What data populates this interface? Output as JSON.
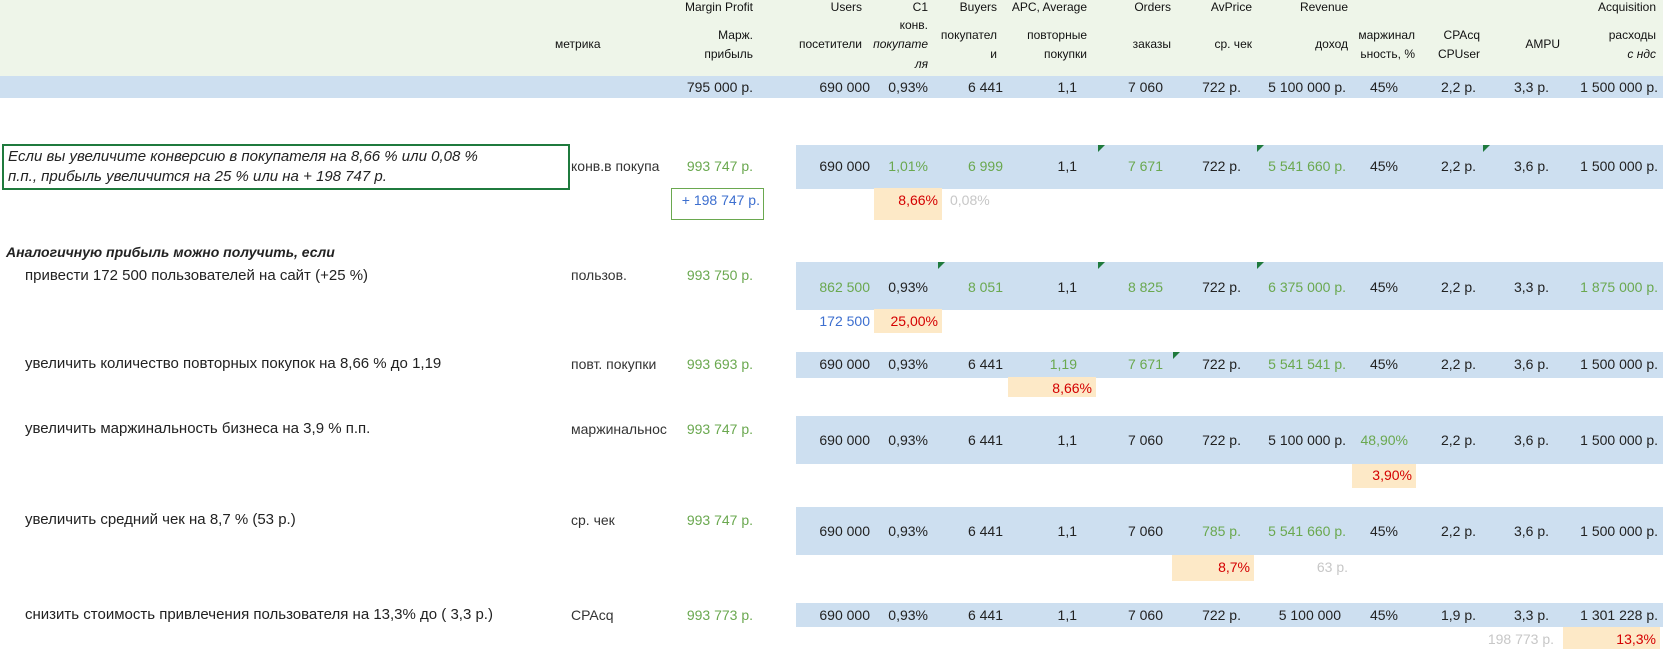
{
  "headers": {
    "metric": "метрика",
    "margin_profit": [
      "Margin Profit",
      "Марж.",
      "прибыль"
    ],
    "users": [
      "Users",
      "посетители"
    ],
    "c1": [
      "C1",
      "конв.",
      "покупате",
      "ля"
    ],
    "buyers": [
      "Buyers",
      "покупател",
      "и"
    ],
    "apc": [
      "APC, Average",
      "повторные",
      "покупки"
    ],
    "orders": [
      "Orders",
      "заказы"
    ],
    "avprice": [
      "AvPrice",
      "ср. чек"
    ],
    "revenue": [
      "Revenue",
      "доход"
    ],
    "margin": [
      "маржинал",
      "ьность, %"
    ],
    "cpacq": [
      "CPAcq",
      "CPUser"
    ],
    "ampu": "AMPU",
    "acquisition": [
      "Acquisition",
      "расходы",
      "с ндс"
    ]
  },
  "base_row": {
    "margin_profit": "795 000 р.",
    "users": "690 000",
    "c1": "0,93%",
    "buyers": "6 441",
    "apc": "1,1",
    "orders": "7 060",
    "avprice": "722 р.",
    "revenue": "5 100 000 р.",
    "margin": "45%",
    "cpacq": "2,2 р.",
    "ampu": "3,3 р.",
    "acq": "1 500 000 р."
  },
  "scenario1": {
    "text_line1": "Если вы увеличите конверсию в покупателя на 8,66 % или 0,08 %",
    "text_line2": "п.п., прибыль увеличится на  25 % или на + 198 747  р.",
    "metric": "конв.в покупа",
    "margin_profit": "993 747 р.",
    "users": "690 000",
    "c1": "1,01%",
    "buyers": "6 999",
    "apc": "1,1",
    "orders": "7 671",
    "avprice": "722 р.",
    "revenue": "5 541 660 р.",
    "margin": "45%",
    "cpacq": "2,2 р.",
    "ampu": "3,6 р.",
    "acq": "1 500 000 р.",
    "delta": "+ 198 747 р.",
    "c1_change": "8,66%",
    "c1_pp": "0,08%"
  },
  "similar_title": "Аналогичную прибыль можно получить, если",
  "scenario2": {
    "text": "привести 172 500 пользователей на сайт (+25 %)",
    "metric": "пользов.",
    "margin_profit": "993 750 р.",
    "users": "862 500",
    "c1": "0,93%",
    "buyers": "8 051",
    "apc": "1,1",
    "orders": "8 825",
    "avprice": "722 р.",
    "revenue": "6 375 000 р.",
    "margin": "45%",
    "cpacq": "2,2 р.",
    "ampu": "3,3 р.",
    "acq": "1 875 000 р.",
    "users_delta": "172 500",
    "users_change": "25,00%"
  },
  "scenario3": {
    "text": "увеличить количество повторных покупок на 8,66 % до 1,19",
    "metric": "повт. покупки",
    "margin_profit": "993 693 р.",
    "users": "690 000",
    "c1": "0,93%",
    "buyers": "6 441",
    "apc": "1,19",
    "orders": "7 671",
    "avprice": "722 р.",
    "revenue": "5 541 541 р.",
    "margin": "45%",
    "cpacq": "2,2 р.",
    "ampu": "3,6 р.",
    "acq": "1 500 000 р.",
    "apc_change": "8,66%"
  },
  "scenario4": {
    "text": "увеличить маржинальность бизнеса на 3,9 % п.п.",
    "metric": "маржинальнос",
    "margin_profit": "993 747 р.",
    "users": "690 000",
    "c1": "0,93%",
    "buyers": "6 441",
    "apc": "1,1",
    "orders": "7 060",
    "avprice": "722 р.",
    "revenue": "5 100 000 р.",
    "margin": "48,90%",
    "cpacq": "2,2 р.",
    "ampu": "3,6 р.",
    "acq": "1 500 000 р.",
    "margin_change": "3,90%"
  },
  "scenario5": {
    "text": "увеличить средний чек на 8,7 % (53 р.)",
    "metric": "ср. чек",
    "margin_profit": "993 747 р.",
    "users": "690 000",
    "c1": "0,93%",
    "buyers": "6 441",
    "apc": "1,1",
    "orders": "7 060",
    "avprice": "785 р.",
    "revenue": "5 541 660 р.",
    "margin": "45%",
    "cpacq": "2,2 р.",
    "ampu": "3,6 р.",
    "acq": "1 500 000 р.",
    "avprice_change": "8,7%",
    "avprice_delta": "63 р."
  },
  "scenario6": {
    "text": "снизить стоимость привлечения пользователя на 13,3% до ( 3,3 р.)",
    "metric": "CPAcq",
    "margin_profit": "993 773 р.",
    "users": "690 000",
    "c1": "0,93%",
    "buyers": "6 441",
    "apc": "1,1",
    "orders": "7 060",
    "avprice": "722 р.",
    "revenue": "5 100 000",
    "margin": "45%",
    "cpacq": "1,9 р.",
    "ampu": "3,3 р.",
    "acq": "1 301 228 р.",
    "acq_delta": "198 773 р.",
    "acq_change": "13,3%"
  },
  "colors": {
    "header_bg": "#eef5e9",
    "row_blue": "#cddff0",
    "highlight": "#fde9c7",
    "green_text": "#6aa84f",
    "red_text": "#d40000",
    "blue_text": "#3d6fcf"
  }
}
